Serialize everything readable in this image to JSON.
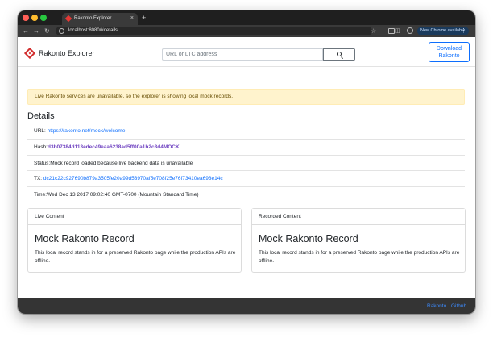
{
  "browser": {
    "tab_title": "Rakonto Explorer",
    "tab_close": "×",
    "new_tab": "+",
    "url": "localhost:8080/#details",
    "update_label": "New Chrome available",
    "menu_glyph": "⋮",
    "nav": {
      "back": "←",
      "forward": "→",
      "reload": "↻",
      "star": "☆",
      "panel": "◫"
    }
  },
  "header": {
    "brand": "Rakonto Explorer",
    "search_placeholder": "URL or LTC address",
    "download_label": "Download Rakonto"
  },
  "alert": {
    "text": "Live Rakonto services are unavailable, so the explorer is showing local mock records."
  },
  "details": {
    "title": "Details",
    "url_label": "URL: ",
    "url_value": "https://rakonto.net/mock/welcome",
    "hash_label": "Hash:",
    "hash_value": "d3b07384d113edec49eaa6238ad5ff00a1b2c3d4MOCK",
    "status_label": "Status:",
    "status_value": "Mock record loaded because live backend data is unavailable",
    "tx_label": "TX: ",
    "tx_value": "dc21c22c927690b879a3505fe20a99d53970af5e708f25e76f73410ea693e14c",
    "time_label": "Time:",
    "time_value": "Wed Dec 13 2017 09:02:40 GMT-0700 (Mountain Standard Time)"
  },
  "cards": {
    "live": {
      "header": "Live Content",
      "title": "Mock Rakonto Record",
      "text": "This local record stands in for a preserved Rakonto page while the production APIs are offline."
    },
    "recorded": {
      "header": "Recorded Content",
      "title": "Mock Rakonto Record",
      "text": "This local record stands in for a preserved Rakonto page while the production APIs are offline."
    }
  },
  "footer": {
    "links": [
      "Rakonto",
      "Github"
    ]
  },
  "colors": {
    "accent": "#0d6efd",
    "alert_bg": "#fff3cd",
    "hash": "#6f42c1",
    "brand_red": "#d32f2f",
    "footer_bg": "#343434"
  }
}
